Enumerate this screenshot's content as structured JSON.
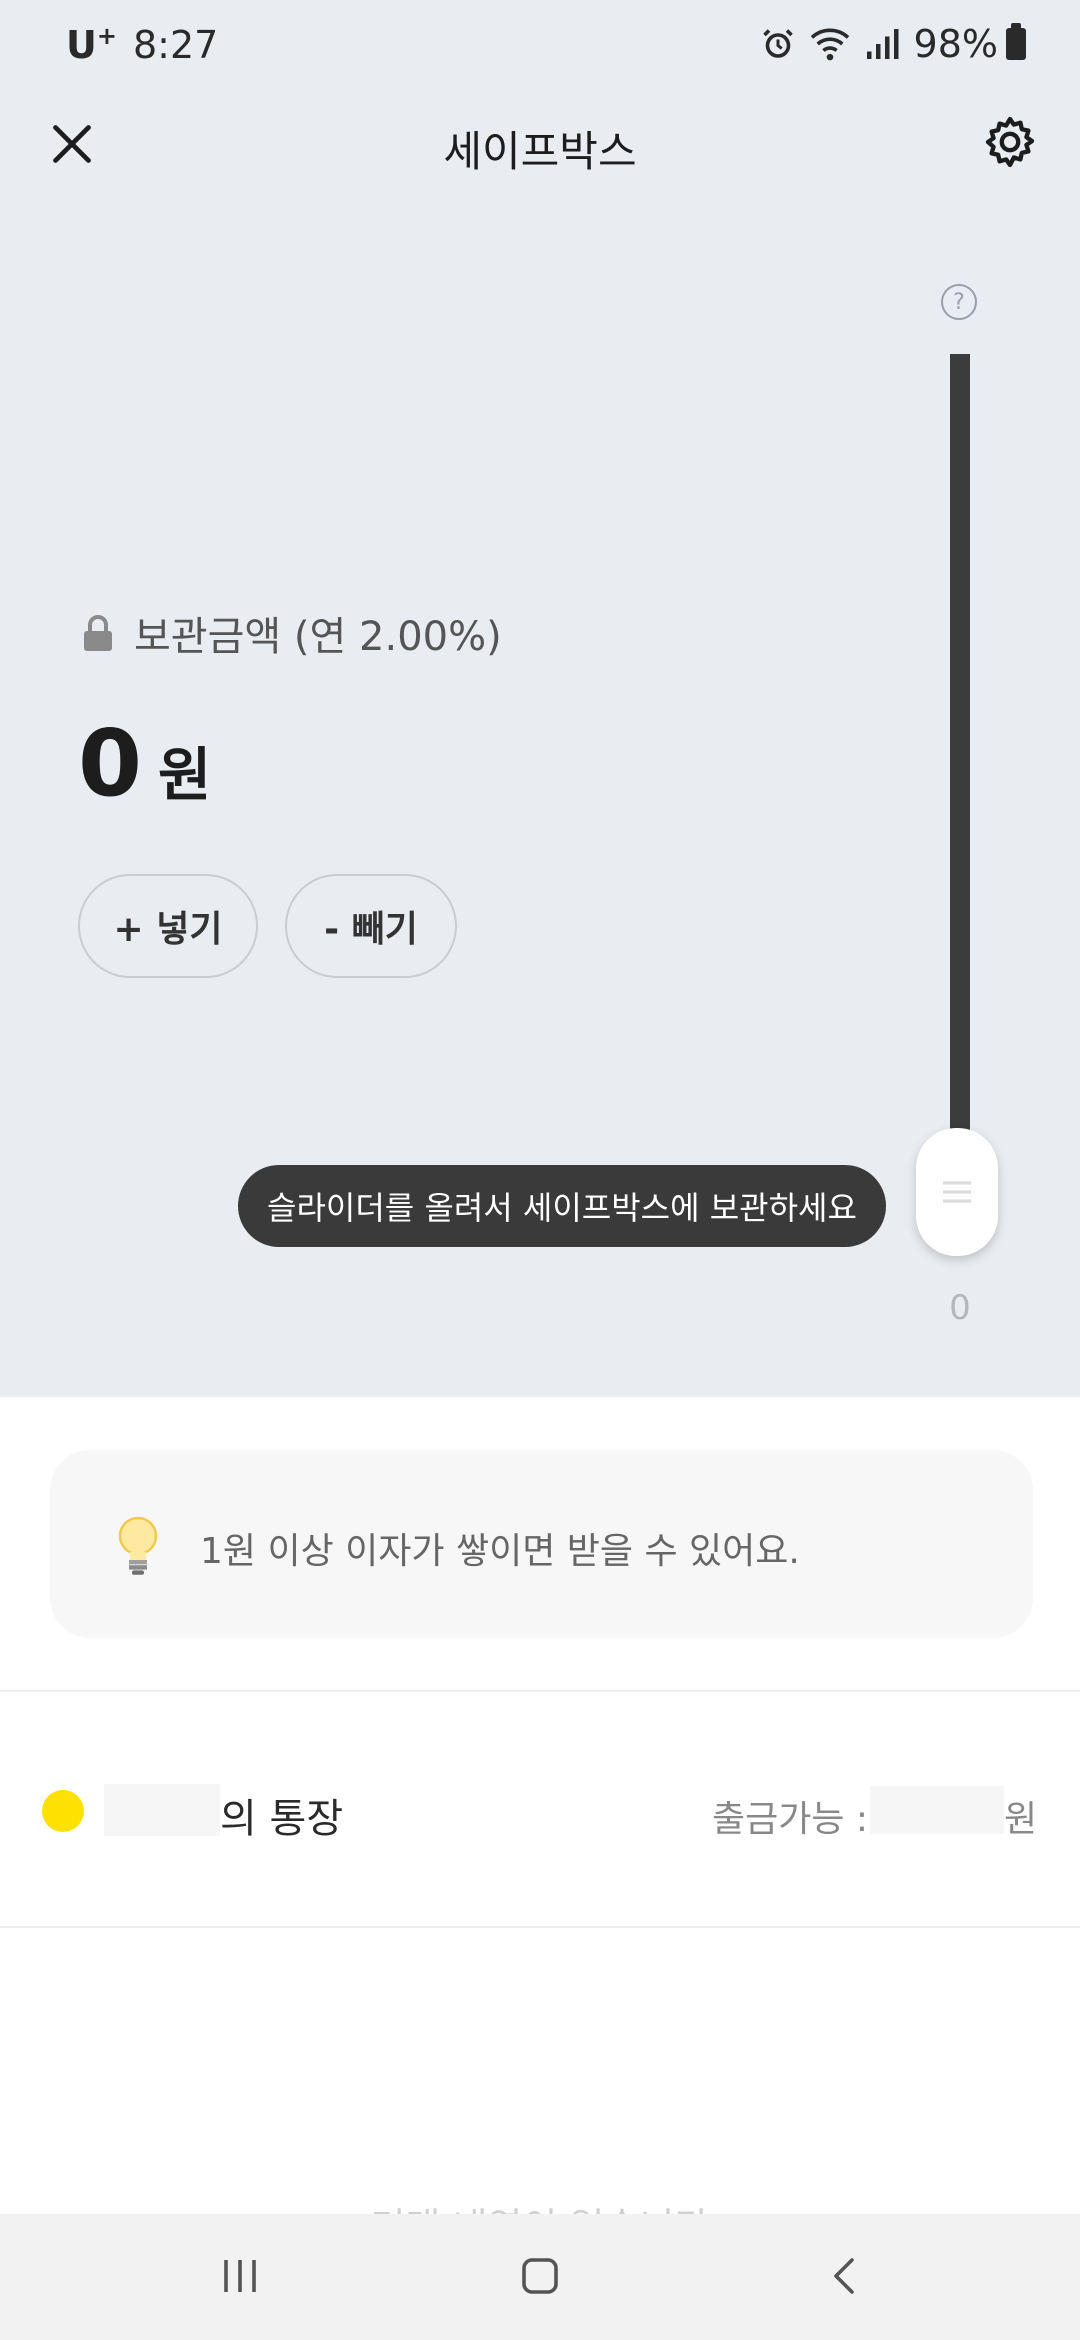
{
  "status_bar": {
    "carrier": "U",
    "carrier_sup": "+",
    "time": "8:27",
    "battery": "98%",
    "icons": [
      "alarm-icon",
      "wifi-icon",
      "signal-icon",
      "battery-icon"
    ]
  },
  "header": {
    "title": "세이프박스",
    "close_icon": "close-icon",
    "settings_icon": "gear-icon"
  },
  "balance": {
    "label": "보관금액 (연 2.00%)",
    "amount": "0",
    "unit": "원",
    "deposit_label": "+ 넣기",
    "withdraw_label": "- 빼기"
  },
  "slider": {
    "help": "?",
    "value": "0",
    "level": 0,
    "tooltip": "슬라이더를 올려서 세이프박스에 보관하세요"
  },
  "info": {
    "text": "1원 이상 이자가 쌓이면 받을 수 있어요."
  },
  "account": {
    "label": "의 통장",
    "withdraw_label": "출금가능 :",
    "won": "원",
    "dot_color": "#FFE100"
  },
  "footer": {
    "faded_text": "거래 내역이 없습니다"
  },
  "colors": {
    "top_bg": "#E9ECF0",
    "track": "#3C3C3C",
    "tooltip_bg": "#3A3A3A",
    "accent": "#FFE100"
  }
}
